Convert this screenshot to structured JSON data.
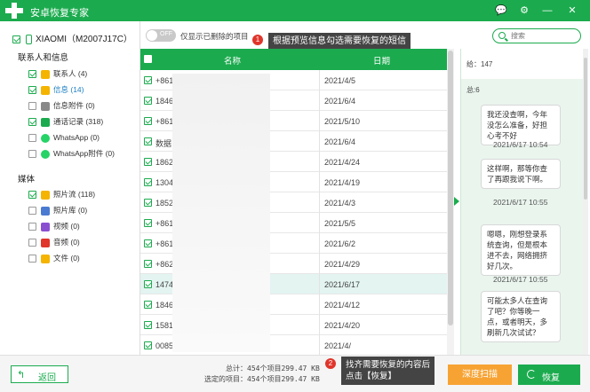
{
  "app": {
    "title": "安卓恢复专家"
  },
  "window_controls": {
    "feedback": "💬",
    "settings": "⚙",
    "minimize": "—",
    "close": "✕"
  },
  "device": {
    "name": "XIAOMI（M2007J17C）"
  },
  "sidebar": {
    "sections": [
      {
        "title": "联系人和信息",
        "items": [
          {
            "label": "联系人 (4)",
            "icon_color": "#f4b400",
            "checked": true
          },
          {
            "label": "信息 (14)",
            "icon_color": "#f4b400",
            "checked": true,
            "active": true
          },
          {
            "label": "信息附件 (0)",
            "icon_color": "#888888",
            "checked": false
          },
          {
            "label": "通话记录 (318)",
            "icon_color": "#1bab4e",
            "checked": true
          },
          {
            "label": "WhatsApp (0)",
            "icon_color": "#25d366",
            "checked": false
          },
          {
            "label": "WhatsApp附件 (0)",
            "icon_color": "#25d366",
            "checked": false
          }
        ]
      },
      {
        "title": "媒体",
        "items": [
          {
            "label": "照片流 (118)",
            "icon_color": "#f4b400",
            "checked": true
          },
          {
            "label": "照片库 (0)",
            "icon_color": "#4a7bd1",
            "checked": false
          },
          {
            "label": "视频 (0)",
            "icon_color": "#8a4fd1",
            "checked": false
          },
          {
            "label": "音频 (0)",
            "icon_color": "#e0352b",
            "checked": false
          },
          {
            "label": "文件 (0)",
            "icon_color": "#f4b400",
            "checked": false
          }
        ]
      }
    ]
  },
  "toolbar": {
    "toggle_text": "OFF",
    "toggle_label": "仅显示已删除的项目"
  },
  "callouts": {
    "one": {
      "num": "1",
      "text": "根据预览信息勾选需要恢复的短信"
    },
    "two": {
      "num": "2",
      "text_line1": "找齐需要恢复的内容后",
      "text_line2": "点击【恢复】"
    }
  },
  "table": {
    "headers": {
      "name": "名称",
      "date": "日期"
    },
    "rows": [
      {
        "name": "+861",
        "date": "2021/4/5",
        "highlight": false
      },
      {
        "name": "1846",
        "date": "2021/6/4",
        "highlight": false
      },
      {
        "name": "+861",
        "date": "2021/5/10",
        "highlight": false
      },
      {
        "name": "数据",
        "date": "2021/6/4",
        "highlight": false
      },
      {
        "name": "1862",
        "date": "2021/4/24",
        "highlight": false
      },
      {
        "name": "1304",
        "date": "2021/4/19",
        "highlight": false
      },
      {
        "name": "1852",
        "date": "2021/4/3",
        "highlight": false
      },
      {
        "name": "+861",
        "date": "2021/5/5",
        "highlight": false
      },
      {
        "name": "+861",
        "date": "2021/6/2",
        "highlight": false
      },
      {
        "name": "+862",
        "date": "2021/4/29",
        "highlight": false
      },
      {
        "name": "1474",
        "date": "2021/6/17",
        "highlight": true
      },
      {
        "name": "1846",
        "date": "2021/4/12",
        "highlight": false
      },
      {
        "name": "1581",
        "date": "2021/4/20",
        "highlight": false
      },
      {
        "name": "0085",
        "date": "2021/4/",
        "highlight": false
      }
    ]
  },
  "search": {
    "placeholder": "搜索"
  },
  "message_panel": {
    "to": "给：147",
    "count": "总:6",
    "messages": [
      {
        "text": "我还没查啊，今年没怎么准备，好担心考不好"
      },
      {
        "time": "2021/6/17 10:54"
      },
      {
        "text": "这样啊，那等你查了再跟我说下啊。"
      },
      {
        "time": "2021/6/17 10:55"
      },
      {
        "text": "嗯嗯，刚想登录系统查询，但是根本进不去，网络拥挤好几次。"
      },
      {
        "time": "2021/6/17 10:55"
      },
      {
        "text": "可能太多人在查询了吧？你等晚一点，或者明天，多刷新几次试试？"
      }
    ]
  },
  "footer": {
    "back_label": "返回",
    "total_line": "总计：454个项目299.47 KB",
    "selected_line": "选定的项目：454个项目299.47 KB",
    "deep_scan_label": "深度扫描",
    "recover_label": "恢复"
  },
  "colors": {
    "brand": "#1bab4e",
    "deep_scan": "#f7a333",
    "callout_badge": "#e0352b"
  }
}
